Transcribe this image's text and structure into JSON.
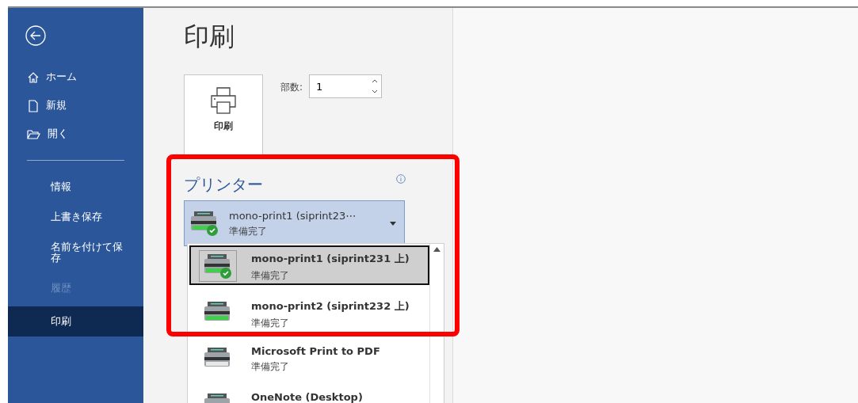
{
  "sidebar": {
    "items": [
      {
        "kind": "icon_nav",
        "label": "ホーム",
        "selected": false,
        "disabled": false
      },
      {
        "kind": "icon_nav",
        "label": "新規",
        "selected": false,
        "disabled": false
      },
      {
        "kind": "icon_nav",
        "label": "開く",
        "selected": false,
        "disabled": false
      },
      {
        "kind": "divider"
      },
      {
        "kind": "nav",
        "label": "情報",
        "selected": false,
        "disabled": false
      },
      {
        "kind": "nav",
        "label": "上書き保存",
        "selected": false,
        "disabled": false
      },
      {
        "kind": "nav",
        "label": "名前を付けて保存",
        "selected": false,
        "disabled": false
      },
      {
        "kind": "nav",
        "label": "履歴",
        "selected": false,
        "disabled": true
      },
      {
        "kind": "nav",
        "label": "印刷",
        "selected": true,
        "disabled": false
      }
    ]
  },
  "title": "印刷",
  "print_button": {
    "label": "印刷"
  },
  "copies": {
    "label": "部数:",
    "value": "1"
  },
  "printer": {
    "heading": "プリンター",
    "current": {
      "name": "mono-print1 (siprint23⋯",
      "status": "準備完了",
      "accent": true,
      "badge": true
    },
    "options": [
      {
        "name": "mono-print1 (siprint231 上)",
        "status": "準備完了",
        "accent": true,
        "badge": true,
        "selected": true
      },
      {
        "name": "mono-print2 (siprint232 上)",
        "status": "準備完了",
        "accent": true,
        "badge": false,
        "selected": false
      },
      {
        "name": "Microsoft Print to PDF",
        "status": "準備完了",
        "accent": false,
        "badge": false,
        "selected": false
      },
      {
        "name": "OneNote (Desktop)",
        "selected": false
      }
    ]
  }
}
